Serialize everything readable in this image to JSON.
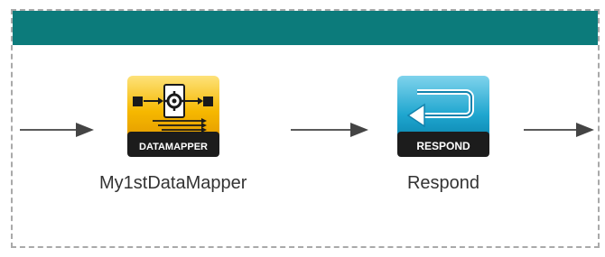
{
  "flow": {
    "header_color": "#0c7b7b",
    "nodes": [
      {
        "id": "datamapper",
        "name": "My1stDataMapper",
        "badge": "DATAMAPPER",
        "icon": "datamapper-icon",
        "accent": "#f6b800"
      },
      {
        "id": "respond",
        "name": "Respond",
        "badge": "RESPOND",
        "icon": "respond-icon",
        "accent": "#1fa6cf"
      }
    ]
  }
}
